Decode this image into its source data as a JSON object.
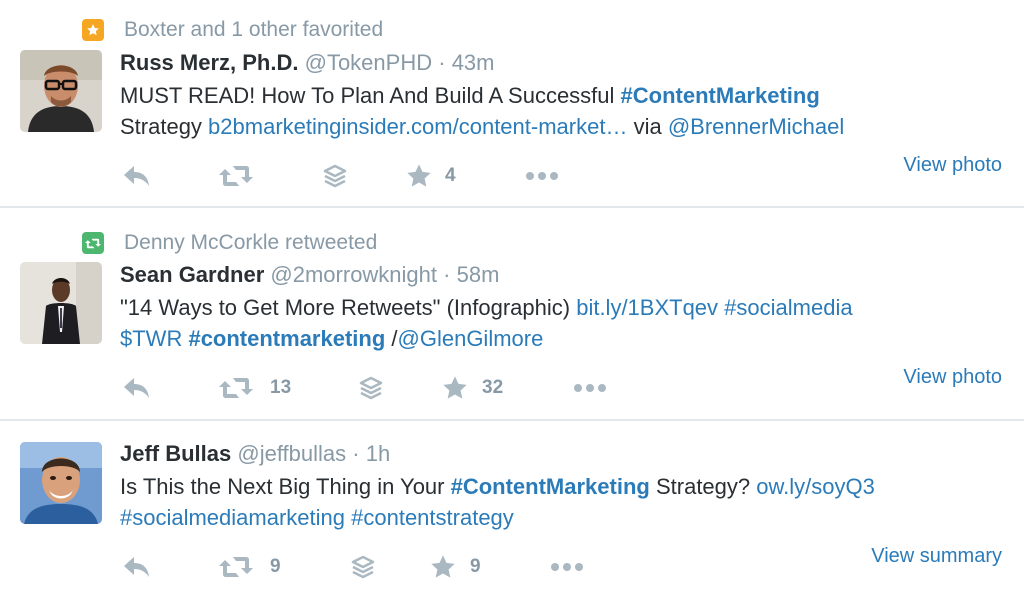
{
  "tweets": [
    {
      "context": {
        "type": "favorite",
        "text": "Boxter and 1 other favorited"
      },
      "name": "Russ Merz, Ph.D.",
      "handle": "@TokenPHD",
      "sep": "·",
      "time": "43m",
      "text": {
        "t1": "MUST READ! How To Plan And Build A Successful ",
        "l1": "#ContentMarketing",
        "t2": "Strategy ",
        "l2": "b2bmarketinginsider.com/content-market…",
        "t3": " via ",
        "l3": "@BrennerMichael"
      },
      "retweets": "",
      "favorites": "4",
      "view": "View photo"
    },
    {
      "context": {
        "type": "retweet",
        "text": "Denny McCorkle retweeted"
      },
      "name": "Sean Gardner",
      "handle": "@2morrowknight",
      "sep": "·",
      "time": "58m",
      "text": {
        "t1": "\"14 Ways to Get More Retweets\" (Infographic) ",
        "l1": "bit.ly/1BXTqev",
        "t2": " ",
        "l2": "#socialmedia",
        "l3": "$TWR",
        "t3": " ",
        "l4": "#contentmarketing",
        "t4": " /",
        "l5": "@GlenGilmore"
      },
      "retweets": "13",
      "favorites": "32",
      "view": "View photo"
    },
    {
      "name": "Jeff Bullas",
      "handle": "@jeffbullas",
      "sep": "·",
      "time": "1h",
      "text": {
        "t1": "Is This the Next Big Thing in Your ",
        "l1": "#ContentMarketing",
        "t2": " Strategy? ",
        "l2": "ow.ly/soyQ3",
        "l3": "#socialmediamarketing",
        "t3": " ",
        "l4": "#contentstrategy"
      },
      "retweets": "9",
      "favorites": "9",
      "view": "View summary"
    }
  ],
  "colors": {
    "accent": "#2b7bb9",
    "muted": "#8899a6",
    "icon": "#aab8c2",
    "fav_badge": "#f5a623",
    "rt_badge": "#4db76f"
  }
}
